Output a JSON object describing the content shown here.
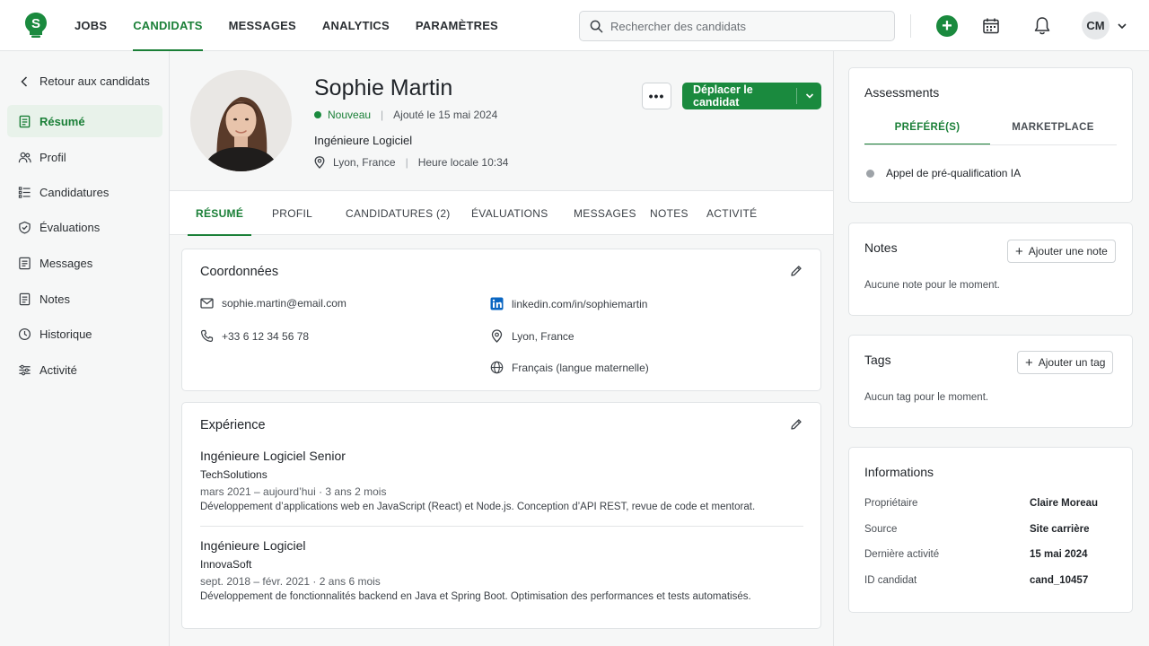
{
  "nav": {
    "items": [
      "JOBS",
      "CANDIDATS",
      "MESSAGES",
      "ANALYTICS",
      "PARAMÈTRES"
    ],
    "active_index": 1
  },
  "search": {
    "placeholder": "Rechercher des candidats"
  },
  "user": {
    "initials": "CM"
  },
  "sidebar": {
    "back_label": "Retour aux candidats",
    "items": [
      {
        "label": "Résumé",
        "icon": "document-icon"
      },
      {
        "label": "Profil",
        "icon": "users-icon"
      },
      {
        "label": "Candidatures",
        "icon": "list-icon"
      },
      {
        "label": "Évaluations",
        "icon": "shield-check-icon"
      },
      {
        "label": "Messages",
        "icon": "message-icon"
      },
      {
        "label": "Notes",
        "icon": "note-icon"
      },
      {
        "label": "Historique",
        "icon": "clock-icon"
      },
      {
        "label": "Activité",
        "icon": "sliders-icon"
      }
    ],
    "active_index": 0
  },
  "candidate": {
    "name": "Sophie Martin",
    "status": "Nouveau",
    "added": "Ajouté le 15 mai 2024",
    "title": "Ingénieure Logiciel",
    "location": "Lyon, France",
    "local_time": "Heure locale 10:34"
  },
  "actions": {
    "more": "•••",
    "move": "Déplacer le candidat"
  },
  "tabs": [
    "RÉSUMÉ",
    "PROFIL",
    "CANDIDATURES (2)",
    "ÉVALUATIONS",
    "MESSAGES",
    "NOTES",
    "ACTIVITÉ"
  ],
  "contact": {
    "title": "Coordonnées",
    "email": "sophie.martin@email.com",
    "phone": "+33 6 12 34 56 78",
    "linkedin": "linkedin.com/in/sophiemartin",
    "city": "Lyon, France",
    "language": "Français (langue maternelle)"
  },
  "experience": {
    "title": "Expérience",
    "jobs": [
      {
        "role": "Ingénieure Logiciel Senior",
        "company": "TechSolutions",
        "dates": "mars 2021 – aujourd’hui  ·  3 ans 2 mois",
        "desc": "Développement d’applications web en JavaScript (React) et Node.js. Conception d’API REST, revue de code et mentorat."
      },
      {
        "role": "Ingénieure Logiciel",
        "company": "InnovaSoft",
        "dates": "sept. 2018 – févr. 2021  ·  2 ans 6 mois",
        "desc": "Développement de fonctionnalités backend en Java et Spring Boot. Optimisation des performances et tests automatisés."
      }
    ]
  },
  "assessments": {
    "title": "Assessments",
    "tabs": [
      "PRÉFÉRÉ(S)",
      "MARKETPLACE"
    ],
    "item": "Appel de pré-qualification IA"
  },
  "notes": {
    "title": "Notes",
    "button": "Ajouter une note",
    "empty": "Aucune note pour le moment."
  },
  "tags": {
    "title": "Tags",
    "button": "Ajouter un tag",
    "empty": "Aucun tag pour le moment."
  },
  "info": {
    "title": "Informations",
    "rows": [
      {
        "k": "Propriétaire",
        "v": "Claire Moreau"
      },
      {
        "k": "Source",
        "v": "Site carrière"
      },
      {
        "k": "Dernière activité",
        "v": "15 mai 2024"
      },
      {
        "k": "ID candidat",
        "v": "cand_10457"
      }
    ]
  },
  "colors": {
    "accent": "#1a7f37",
    "accent_bg": "#e8f2ea",
    "button": "#1a8a3e"
  }
}
